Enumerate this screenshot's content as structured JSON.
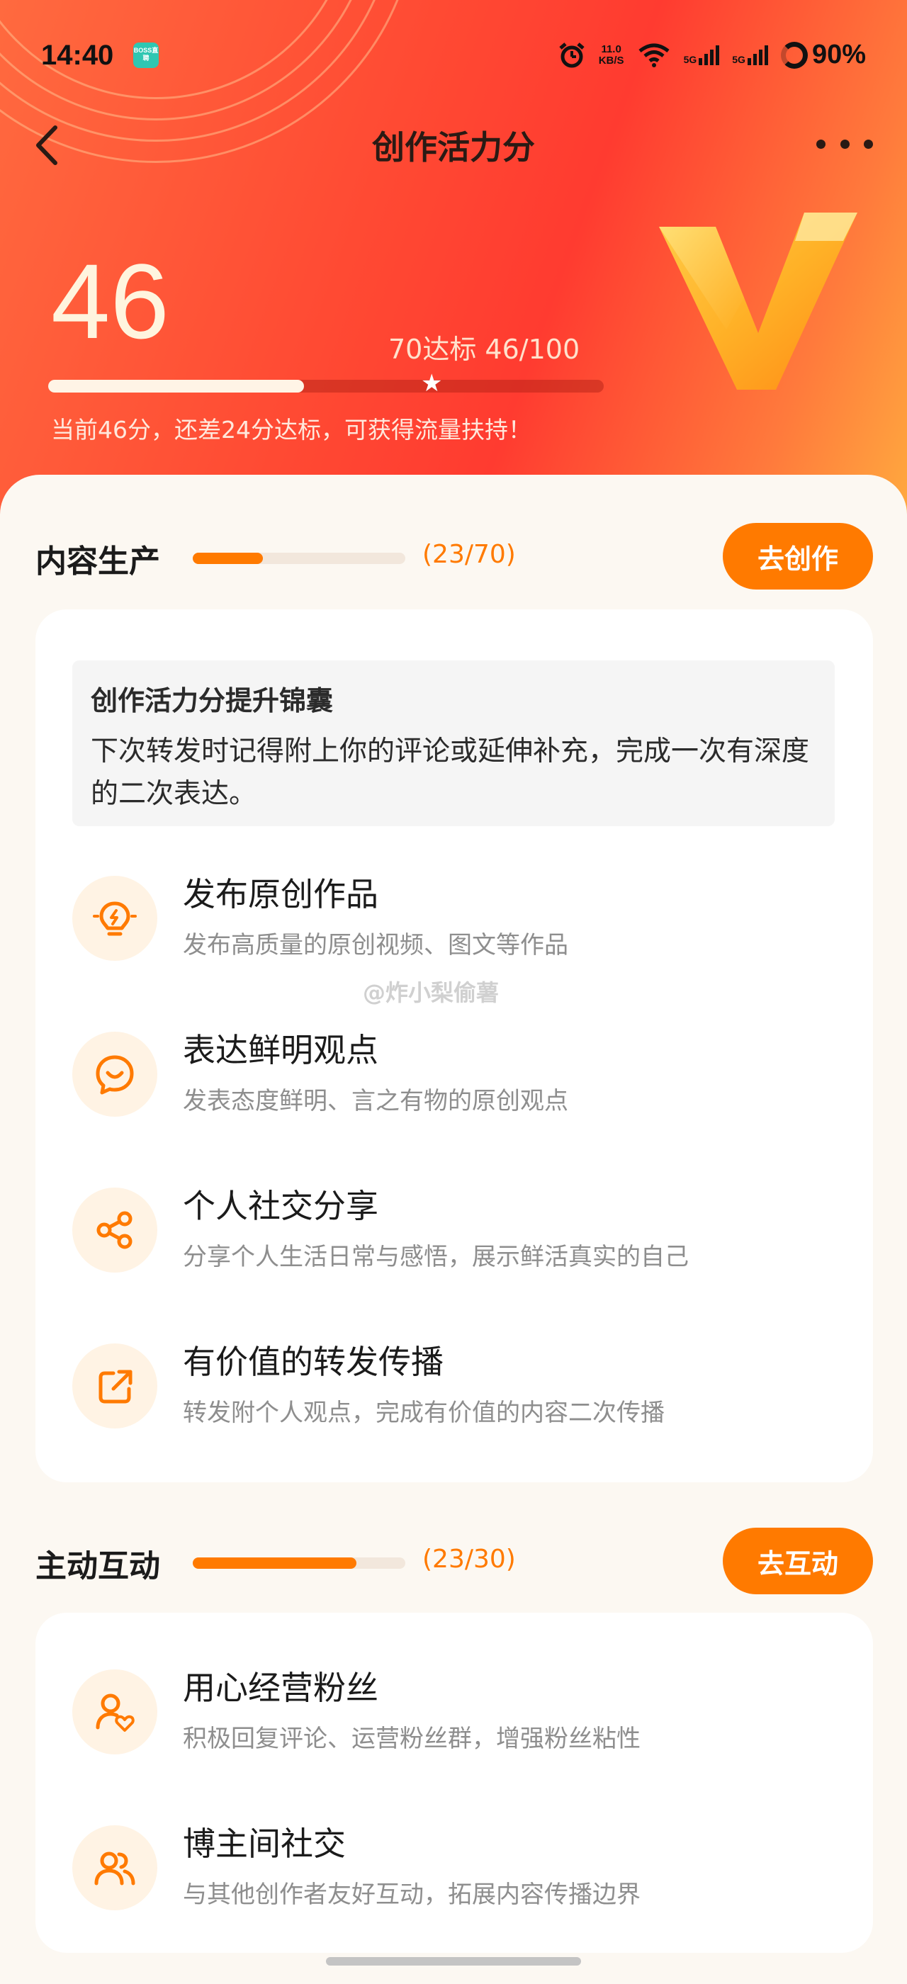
{
  "status_bar": {
    "time": "14:40",
    "app_badge": "BOSS直聘",
    "net_speed_value": "11.0",
    "net_speed_unit": "KB/S",
    "signal_1": "5G",
    "signal_2": "5G",
    "battery": "90%"
  },
  "nav": {
    "title": "创作活力分"
  },
  "hero": {
    "score": "46",
    "target_text": "70达标   46/100",
    "progress_fraction": 0.46,
    "target_fraction": 0.7,
    "hint": "当前46分，还差24分达标，可获得流量扶持！",
    "accent": "#ff7a00"
  },
  "content_section": {
    "title": "内容生产",
    "count": "(23/70)",
    "progress_fraction": 0.33,
    "button": "去创作",
    "tip": {
      "title": "创作活力分提升锦囊",
      "body": "下次转发时记得附上你的评论或延伸补充，完成一次有深度的二次表达。"
    },
    "tasks": [
      {
        "title": "发布原创作品",
        "desc": "发布高质量的原创视频、图文等作品",
        "icon": "lightbulb-icon"
      },
      {
        "title": "表达鲜明观点",
        "desc": "发表态度鲜明、言之有物的原创观点",
        "icon": "chat-smile-icon"
      },
      {
        "title": "个人社交分享",
        "desc": "分享个人生活日常与感悟，展示鲜活真实的自己",
        "icon": "share-icon"
      },
      {
        "title": "有价值的转发传播",
        "desc": "转发附个人观点，完成有价值的内容二次传播",
        "icon": "forward-icon"
      }
    ]
  },
  "interaction_section": {
    "title": "主动互动",
    "count": "(23/30)",
    "progress_fraction": 0.77,
    "button": "去互动",
    "tasks": [
      {
        "title": "用心经营粉丝",
        "desc": "积极回复评论、运营粉丝群，增强粉丝粘性",
        "icon": "user-heart-icon"
      },
      {
        "title": "博主间社交",
        "desc": "与其他创作者友好互动，拓展内容传播边界",
        "icon": "users-icon"
      }
    ]
  },
  "watermark": "@炸小梨偷薯"
}
